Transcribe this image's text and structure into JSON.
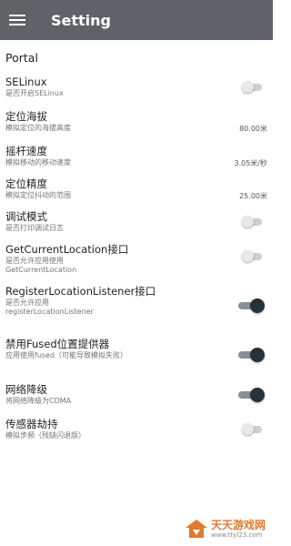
{
  "app_bar": {
    "title": "Setting",
    "menu_icon": "hamburger-menu-icon",
    "background": "#5f6368"
  },
  "section": {
    "title": "Portal"
  },
  "items": [
    {
      "label": "SELinux",
      "sub": "是否开启SELinux",
      "control": "switch",
      "on": false
    },
    {
      "label": "定位海拔",
      "sub": "模拟定位的海拔高度",
      "control": "value",
      "value": "80.00米"
    },
    {
      "label": "摇杆速度",
      "sub": "模拟移动的移动速度",
      "control": "value",
      "value": "3.05米/秒"
    },
    {
      "label": "定位精度",
      "sub": "模拟定位抖动的范围",
      "control": "value",
      "value": "25.00米"
    },
    {
      "label": "调试模式",
      "sub": "是否打印调试日志",
      "control": "switch",
      "on": false
    },
    {
      "label": "GetCurrentLocation接口",
      "sub": "是否允许应用使用 GetCurrentLocation",
      "control": "switch",
      "on": false
    },
    {
      "label": "RegisterLocationListener接口",
      "sub": "是否允许应用 registerLocationListener",
      "control": "switch",
      "on": true
    },
    {
      "label": "禁用Fused位置提供器",
      "sub": "应用使用fused（可能导致模拟失败）",
      "control": "switch",
      "on": true
    },
    {
      "label": "网络降级",
      "sub": "将网络降级为CDMA",
      "control": "switch",
      "on": true
    },
    {
      "label": "传感器劫持",
      "sub": "模拟步频（残缺闪退版）",
      "control": "switch",
      "on": false
    }
  ],
  "watermark": {
    "main": "天天游戏网",
    "url": "www.ttyl23.com"
  },
  "colors": {
    "switch_on_thumb": "#263238",
    "switch_off_thumb": "#e8e8e8",
    "watermark": "#e07a2f"
  }
}
